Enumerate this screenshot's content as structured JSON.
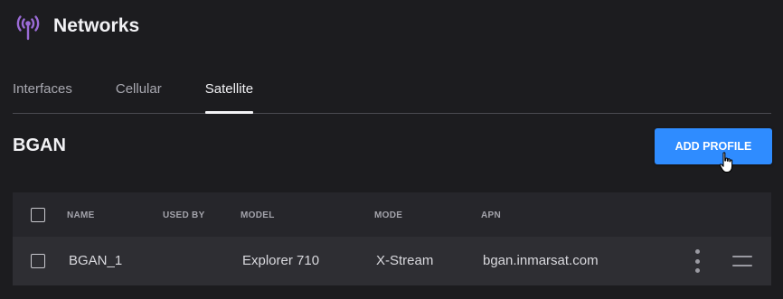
{
  "header": {
    "title": "Networks",
    "icon": "antenna-icon",
    "accent": "#9b6bd6"
  },
  "tabs": [
    {
      "label": "Interfaces",
      "active": false
    },
    {
      "label": "Cellular",
      "active": false
    },
    {
      "label": "Satellite",
      "active": true
    }
  ],
  "section": {
    "title": "BGAN",
    "add_label": "ADD PROFILE",
    "button_color": "#2f8cff"
  },
  "table": {
    "columns": [
      "NAME",
      "USED BY",
      "MODEL",
      "MODE",
      "APN"
    ],
    "rows": [
      {
        "name": "BGAN_1",
        "used_by": "",
        "model": "Explorer 710",
        "mode": "X-Stream",
        "apn": "bgan.inmarsat.com"
      }
    ]
  }
}
